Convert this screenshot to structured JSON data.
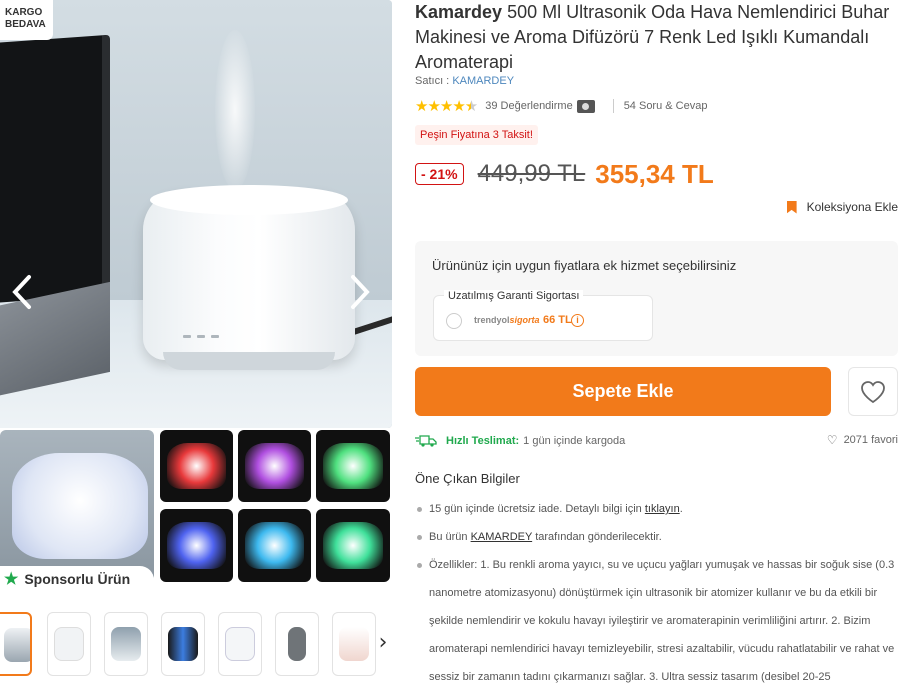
{
  "gallery": {
    "badge_line1": "KARGO",
    "badge_line2": "BEDAVA",
    "sponsored_label": "Sponsorlu Ürün",
    "glow_colors": [
      "#f4f6fa",
      "#e8393b",
      "#b04fe0",
      "#4fe07f",
      "#4f63f0",
      "#3db9ef",
      "#3fe09a"
    ]
  },
  "product": {
    "brand": "Kamardey",
    "title": "500 Ml Ultrasonik Oda Hava Nemlendirici Buhar Makinesi ve Aroma Difüzörü 7 Renk Led Işıklı Kumandalı Aromaterapi",
    "seller_label": "Satıcı :",
    "seller_name": "KAMARDEY",
    "rating": 4.5,
    "review_count": "39 Değerlendirme",
    "qa_count": "54 Soru & Cevap",
    "installment_text": "Peşin Fiyatına 3 Taksit!",
    "discount": "- 21%",
    "old_price": "449,99 TL",
    "new_price": "355,34 TL",
    "collection_label": "Koleksiyona Ekle"
  },
  "services": {
    "title": "Ürününüz için uygun fiyatlara ek hizmet seçebilirsiniz",
    "warranty_label": "Uzatılmış Garanti Sigortası",
    "logo_text_a": "trendyol",
    "logo_text_b": "sigorta",
    "warranty_price": "66 TL"
  },
  "actions": {
    "add_to_cart": "Sepete Ekle"
  },
  "delivery": {
    "fast_label": "Hızlı Teslimat:",
    "fast_text": "1 gün içinde kargoda",
    "favorites": "2071 favori"
  },
  "highlights": {
    "title": "Öne Çıkan Bilgiler",
    "item1_pre": "15 gün içinde ücretsiz iade. Detaylı bilgi için",
    "item1_link": "tıklayın",
    "item1_post": ".",
    "item2_pre": "Bu ürün",
    "item2_seller": "KAMARDEY",
    "item2_post": "tarafından gönderilecektir.",
    "item3": "Özellikler: 1. Bu renkli aroma yayıcı, su ve uçucu yağları yumuşak ve hassas bir soğuk sise (0.3 nanometre atomizasyonu) dönüştürmek için ultrasonik bir atomizer kullanır ve bu da etkili bir şekilde nemlendirir ve kokulu havayı iyileştirir ve aromaterapinin verimliliğini artırır. 2. Bizim aromaterapi nemlendirici havayı temizleyebilir, stresi azaltabilir, vücudu rahatlatabilir ve rahat ve sessiz bir zamanın tadını çıkarmanızı sağlar. 3. Ultra sessiz tasarım (desibel 20-25"
  }
}
